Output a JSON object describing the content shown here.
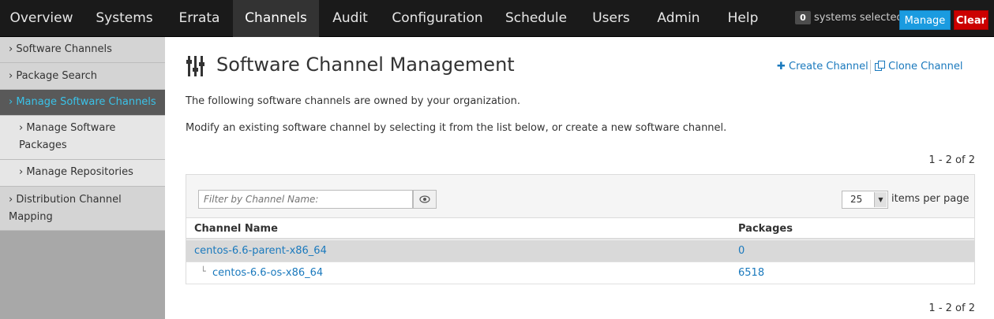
{
  "nav": {
    "items": [
      {
        "label": "Overview"
      },
      {
        "label": "Systems"
      },
      {
        "label": "Errata"
      },
      {
        "label": "Channels"
      },
      {
        "label": "Audit"
      },
      {
        "label": "Configuration"
      },
      {
        "label": "Schedule"
      },
      {
        "label": "Users"
      },
      {
        "label": "Admin"
      },
      {
        "label": "Help"
      }
    ],
    "active": "Channels",
    "systems_count": "0",
    "systems_selected_label": "systems selected",
    "manage_label": "Manage",
    "clear_label": "Clear"
  },
  "sidebar": {
    "items": [
      {
        "label": "› Software Channels"
      },
      {
        "label": "› Package Search"
      },
      {
        "label": "› Manage Software Channels"
      },
      {
        "label": "› Manage Software Packages"
      },
      {
        "label": "› Manage Repositories"
      },
      {
        "label": "› Distribution Channel Mapping"
      }
    ],
    "active": "Manage Software Channels"
  },
  "main": {
    "title": "Software Channel Management",
    "create_channel_label": "Create Channel",
    "clone_channel_label": "Clone Channel",
    "intro_1": "The following software channels are owned by your organization.",
    "intro_2": "Modify an existing software channel by selecting it from the list below, or create a new software channel.",
    "pagination": "1 - 2 of 2",
    "filter_placeholder": "Filter by Channel Name:",
    "per_page_value": "25",
    "per_page_label": "items per page",
    "columns": [
      "Channel Name",
      "Packages"
    ],
    "rows": [
      {
        "name": "centos-6.6-parent-x86_64",
        "packages": "0"
      },
      {
        "name": "centos-6.6-os-x86_64",
        "packages": "6518"
      }
    ]
  },
  "colors": {
    "nav_bg": "#1a1a1a",
    "link": "#1a79bd",
    "manage": "#1a9be0",
    "clear": "#cc0000",
    "sidebar_active_text": "#3ac2e8"
  }
}
